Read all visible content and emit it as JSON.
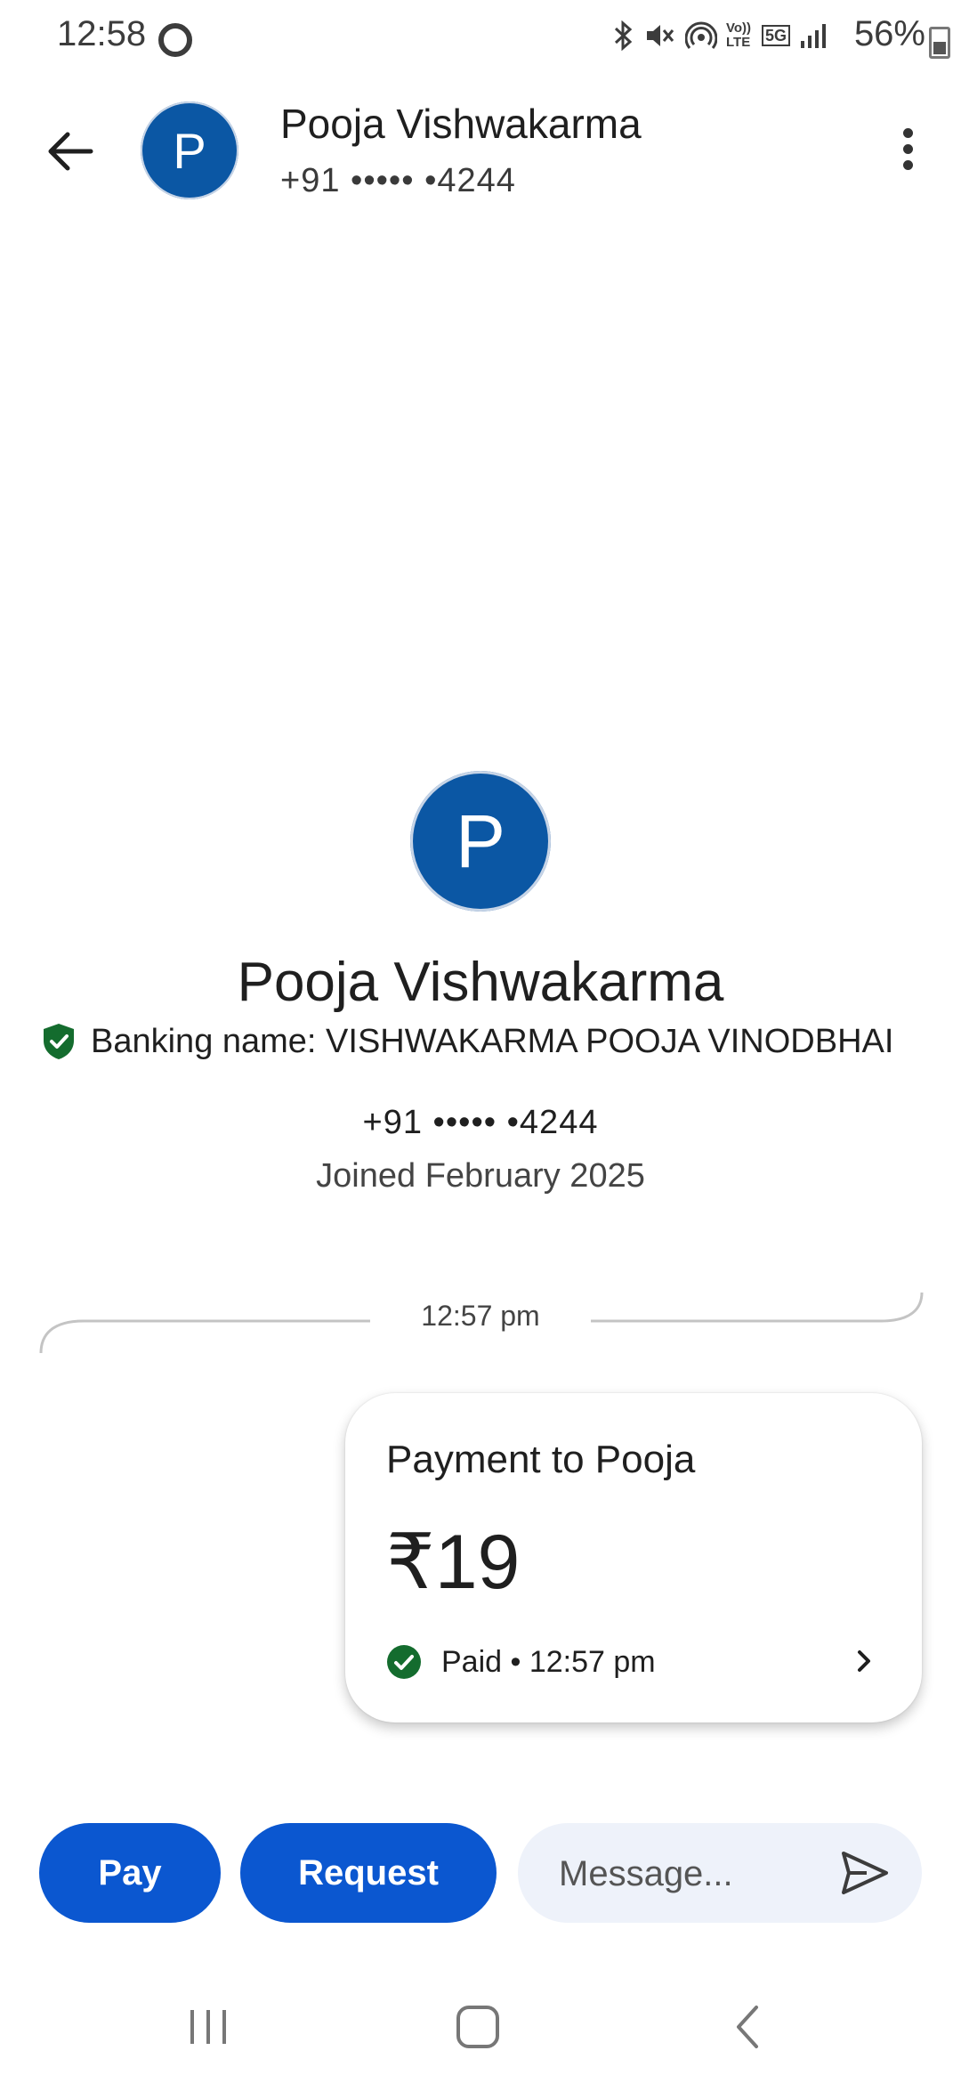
{
  "status_bar": {
    "time": "12:58",
    "battery": "56%",
    "icons": [
      "opera-icon",
      "bluetooth-icon",
      "mute-icon",
      "hotspot-icon",
      "volte-icon",
      "5g-icon",
      "signal-icon",
      "battery-icon"
    ],
    "volte_label": "Vo)) LTE",
    "network_label": "5G"
  },
  "header": {
    "avatar_letter": "P",
    "name": "Pooja Vishwakarma",
    "phone": "+91 ••••• •4244"
  },
  "profile": {
    "avatar_letter": "P",
    "name": "Pooja Vishwakarma",
    "banking_name": "Banking name: VISHWAKARMA POOJA VINODBHAI",
    "phone": "+91 ••••• •4244",
    "joined": "Joined February 2025"
  },
  "thread": {
    "divider_time": "12:57 pm"
  },
  "payment_card": {
    "title": "Payment to Pooja",
    "amount": "₹19",
    "status": "Paid • 12:57 pm"
  },
  "actions": {
    "pay_label": "Pay",
    "request_label": "Request",
    "message_placeholder": "Message..."
  },
  "colors": {
    "avatar": "#0b57a4",
    "primary_button": "#0b57d0",
    "message_box": "#eef2fa",
    "verified_green": "#146c2e"
  }
}
